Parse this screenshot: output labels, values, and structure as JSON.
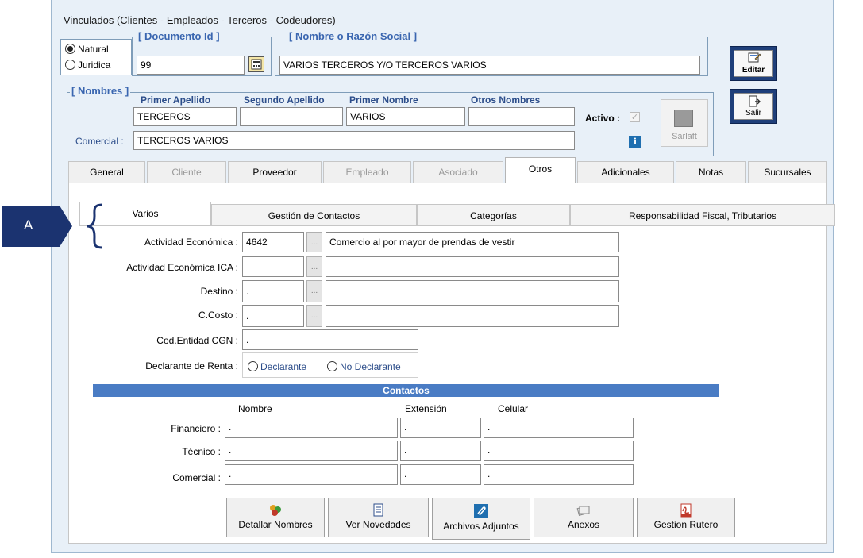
{
  "window": {
    "title": "Vinculados   (Clientes - Empleados - Terceros - Codeudores)"
  },
  "person_type": {
    "natural_label": "Natural",
    "juridica_label": "Juridica",
    "selected": "natural"
  },
  "documento": {
    "legend": "[ Documento Id ]",
    "value": "99"
  },
  "razon_social": {
    "legend": "[ Nombre o Razón Social ]",
    "value": "VARIOS TERCEROS Y/O TERCEROS VARIOS"
  },
  "side_buttons": {
    "editar_label": "Editar",
    "salir_label": "Salir"
  },
  "nombres": {
    "legend": "[ Nombres ]",
    "primer_apellido_label": "Primer Apellido",
    "primer_apellido": "TERCEROS",
    "segundo_apellido_label": "Segundo Apellido",
    "segundo_apellido": "",
    "primer_nombre_label": "Primer Nombre",
    "primer_nombre": "VARIOS",
    "otros_nombres_label": "Otros Nombres",
    "otros_nombres": "",
    "comercial_label": "Comercial :",
    "comercial": "TERCEROS VARIOS",
    "activo_label": "Activo :",
    "sarlaft_label": "Sarlaft"
  },
  "main_tabs": [
    {
      "label": "General"
    },
    {
      "label": "Cliente"
    },
    {
      "label": "Proveedor"
    },
    {
      "label": "Empleado"
    },
    {
      "label": "Asociado"
    },
    {
      "label": "Otros"
    },
    {
      "label": "Adicionales"
    },
    {
      "label": "Notas"
    },
    {
      "label": "Sucursales"
    }
  ],
  "inner_tabs": [
    {
      "label": "Varios"
    },
    {
      "label": "Gestión de Contactos"
    },
    {
      "label": "Categorías"
    },
    {
      "label": "Responsabilidad Fiscal, Tributarios"
    }
  ],
  "annotation": {
    "marker": "A"
  },
  "varios": {
    "actividad_label": "Actividad Económica :",
    "actividad_code": "4642",
    "actividad_desc": "Comercio al por mayor de prendas de vestir",
    "ica_label": "Actividad Económica ICA :",
    "ica_code": "",
    "ica_desc": "",
    "destino_label": "Destino :",
    "destino_code": ".",
    "destino_desc": "",
    "ccosto_label": "C.Costo :",
    "ccosto_code": ".",
    "ccosto_desc": "",
    "cgn_label": "Cod.Entidad CGN :",
    "cgn_value": ".",
    "renta_label": "Declarante de Renta :",
    "declarante_label": "Declarante",
    "no_declarante_label": "No Declarante",
    "ellipsis": "..."
  },
  "contactos": {
    "header": "Contactos",
    "col_nombre": "Nombre",
    "col_extension": "Extensión",
    "col_celular": "Celular",
    "rows": [
      {
        "label": "Financiero :",
        "nombre": ".",
        "extension": ".",
        "celular": "."
      },
      {
        "label": "Técnico :",
        "nombre": ".",
        "extension": ".",
        "celular": "."
      },
      {
        "label": "Comercial :",
        "nombre": ".",
        "extension": ".",
        "celular": "."
      }
    ]
  },
  "bottom_buttons": [
    {
      "label": "Detallar Nombres"
    },
    {
      "label": "Ver Novedades"
    },
    {
      "label": "Archivos Adjuntos"
    },
    {
      "label": "Anexos"
    },
    {
      "label": "Gestion Rutero"
    }
  ],
  "colors": {
    "accent_blue": "#4a7cc4",
    "marker_navy": "#1b3370"
  }
}
